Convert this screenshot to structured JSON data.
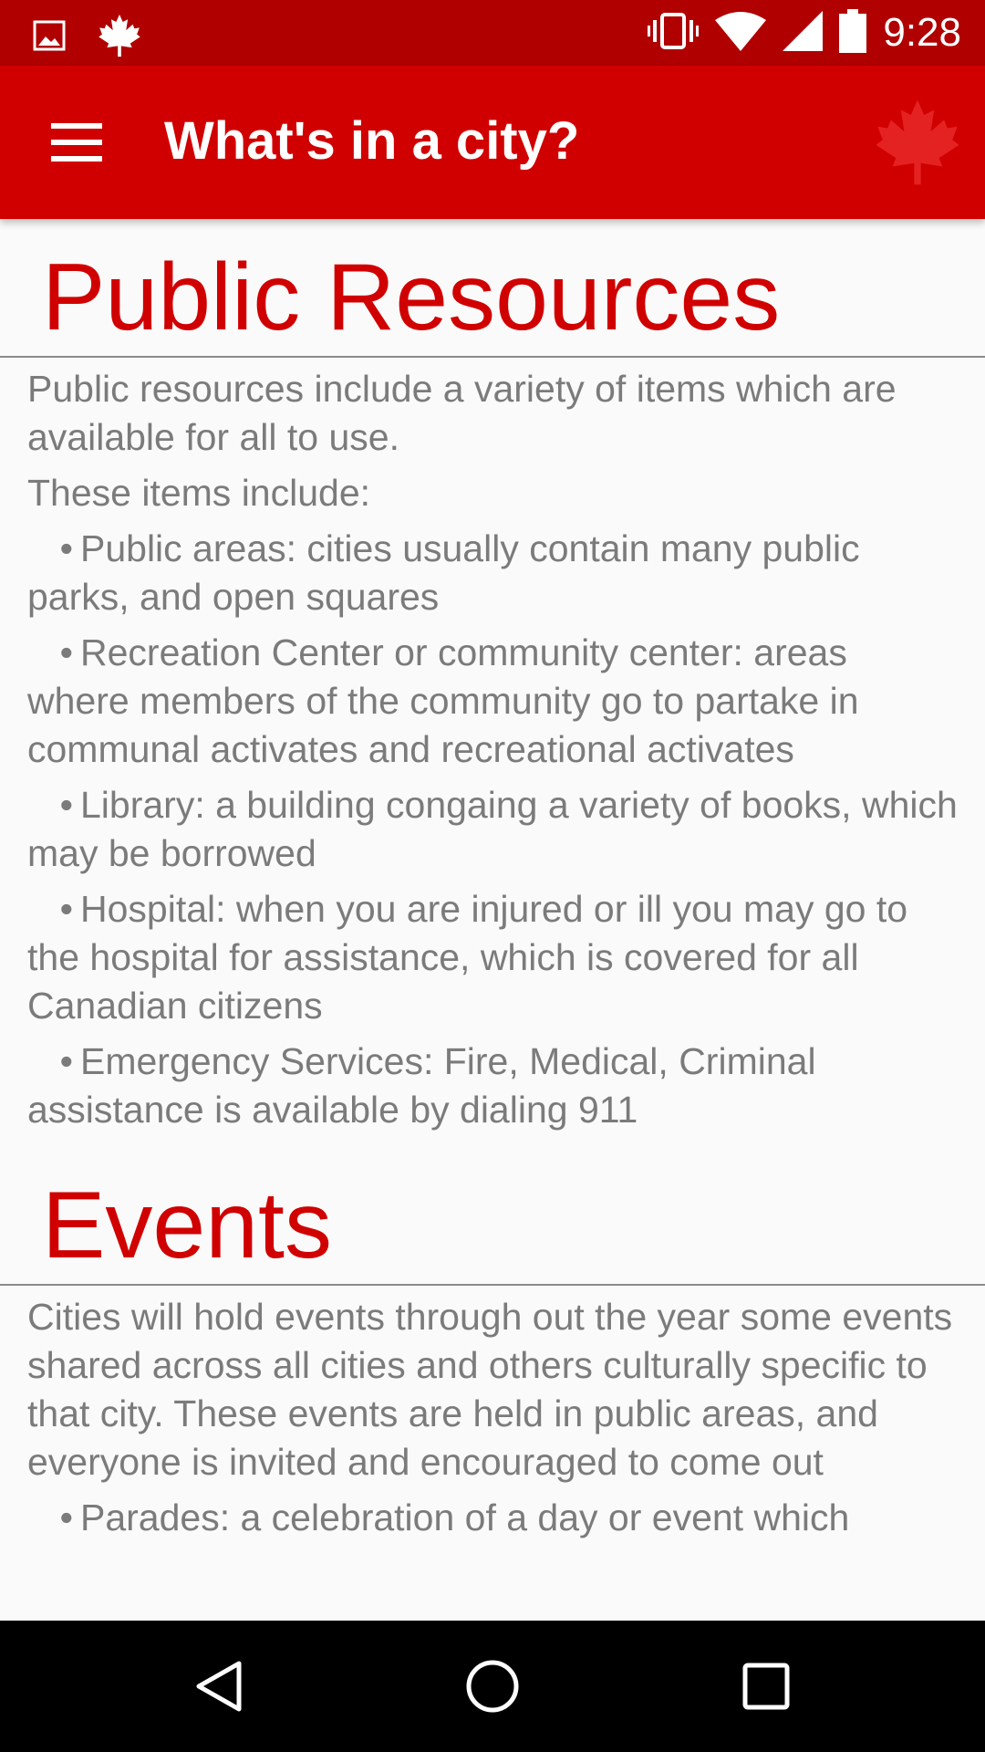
{
  "status_bar": {
    "time": "9:28",
    "left_icons": [
      "image-icon",
      "maple-leaf-icon"
    ],
    "right_icons": [
      "vibrate-icon",
      "wifi-icon",
      "cell-signal-icon",
      "battery-icon"
    ]
  },
  "app_bar": {
    "title": "What's in a city?",
    "menu_icon": "hamburger-menu-icon",
    "logo_icon": "maple-leaf-icon",
    "background_color": "#d10000",
    "status_color": "#b00000"
  },
  "sections": {
    "public_resources": {
      "heading": "Public Resources",
      "intro_1": "Public resources include a variety of items which are available for all to use.",
      "intro_2": "These items include:",
      "bullets": [
        "Public areas: cities usually contain many public parks, and open squares",
        "Recreation Center or community center: areas where members of the community go to partake in communal activates and  recreational activates",
        "Library: a building congaing a variety of books, which may be borrowed",
        "Hospital: when you are injured or ill you may go to the hospital for assistance, which is covered for all Canadian citizens",
        "Emergency Services: Fire, Medical, Criminal assistance is available by dialing 911"
      ]
    },
    "events": {
      "heading": "Events",
      "intro": "Cities will hold events through out the year some events shared across all cities and others culturally specific to that city. These events are held in public areas, and everyone is invited and encouraged to come out",
      "bullets": [
        "Parades: a celebration of a day or event which"
      ]
    }
  },
  "bullet_char": "•",
  "nav_bar": {
    "back_icon": "back-triangle-icon",
    "home_icon": "home-circle-icon",
    "recents_icon": "recents-square-icon"
  }
}
